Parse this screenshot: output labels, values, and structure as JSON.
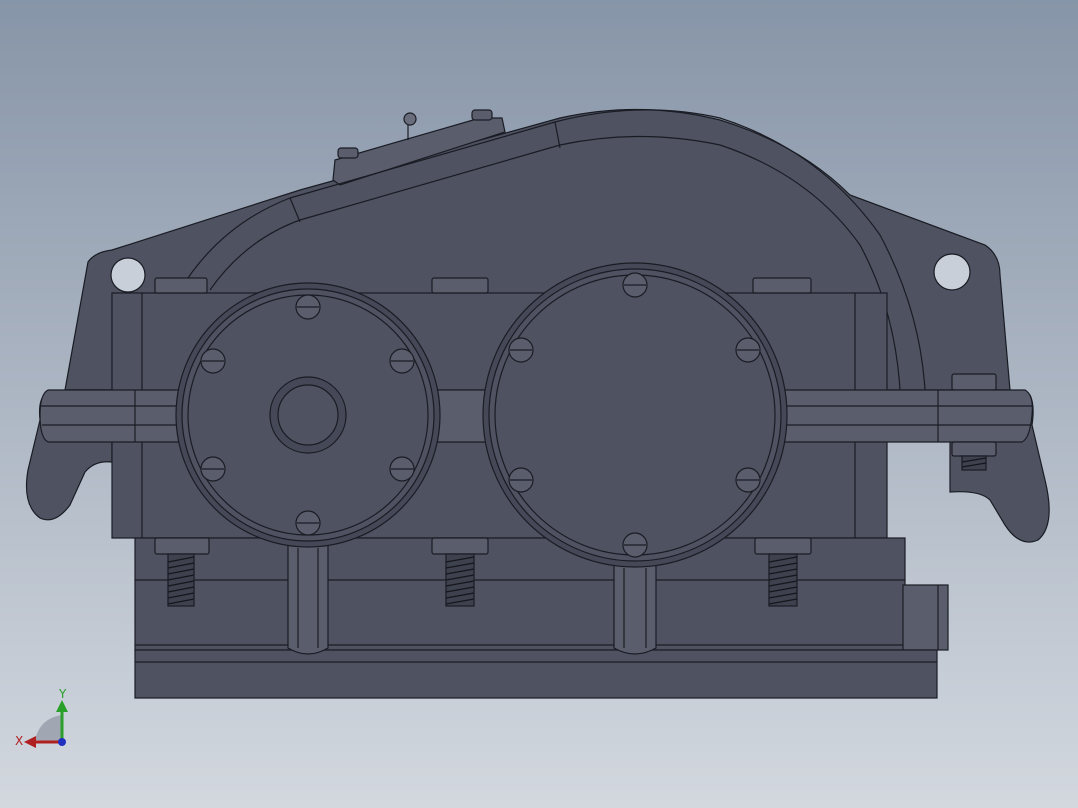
{
  "viewport": {
    "background_top": "#8795a8",
    "background_bottom": "#d3d8df"
  },
  "model": {
    "fill": "#4f5261",
    "fill_dark": "#454856",
    "fill_light": "#5a5d6c",
    "line": "#1a1c24",
    "highlight": "#7a7e8e"
  },
  "triad": {
    "x_label": "X",
    "y_label": "Y",
    "x_color": "#b02020",
    "y_color": "#2aa02a",
    "z_color": "#2030c0"
  }
}
